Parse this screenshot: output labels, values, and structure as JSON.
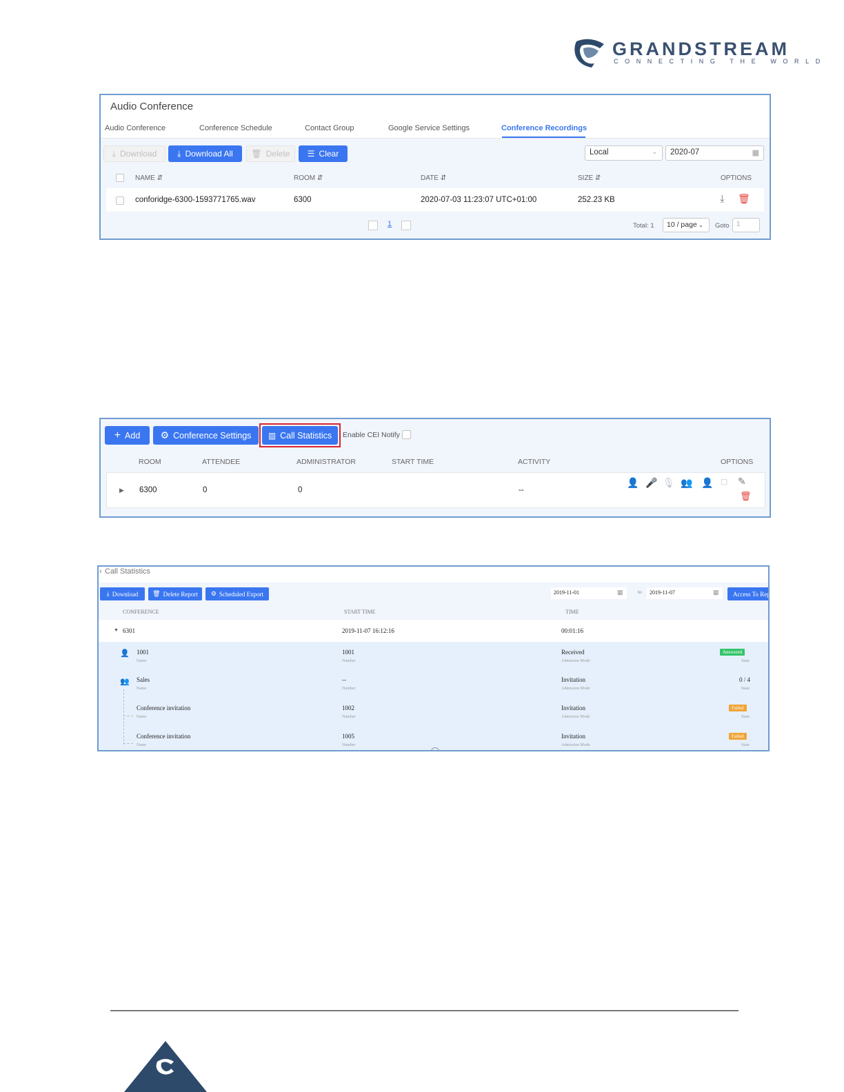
{
  "logo": {
    "word": "GRANDSTREAM",
    "tagline": "CONNECTING THE WORLD"
  },
  "recordings": {
    "title": "Audio Conference",
    "tabs": [
      "Audio Conference",
      "Conference Schedule",
      "Contact Group",
      "Google Service Settings",
      "Conference Recordings"
    ],
    "active_tab": "Conference Recordings",
    "buttons": {
      "download": "Download",
      "download_all": "Download All",
      "delete": "Delete",
      "clear": "Clear"
    },
    "storage": "Local",
    "month": "2020-07",
    "headers": {
      "name": "NAME",
      "room": "ROOM",
      "date": "DATE",
      "size": "SIZE",
      "options": "OPTIONS"
    },
    "rows": [
      {
        "name": "conforidge-6300-1593771765.wav",
        "room": "6300",
        "date": "2020-07-03 11:23:07 UTC+01:00",
        "size": "252.23 KB"
      }
    ],
    "pagination": {
      "page": "1",
      "total": "Total: 1",
      "per_page": "10 / page",
      "goto": "Goto",
      "goto_value": "1"
    }
  },
  "rooms": {
    "buttons": {
      "add": "Add",
      "settings": "Conference Settings",
      "stats": "Call Statistics"
    },
    "cei_label": "Enable CEI Notify",
    "headers": {
      "room": "ROOM",
      "attendee": "ATTENDEE",
      "admin": "ADMINISTRATOR",
      "start": "START TIME",
      "activity": "ACTIVITY",
      "options": "OPTIONS"
    },
    "rows": [
      {
        "room": "6300",
        "attendee": "0",
        "admin": "0",
        "start": "",
        "activity": "--"
      }
    ],
    "highlight_color": "#d9232e"
  },
  "stats": {
    "title": "Call Statistics",
    "buttons": {
      "download": "Download",
      "delete": "Delete Report",
      "export": "Scheduled Export",
      "access": "Access To Rep"
    },
    "date_from": "2019-11-01",
    "date_to": "2019-11-07",
    "to_label": "to",
    "headers": {
      "conference": "CONFERENCE",
      "start": "START TIME",
      "time": "TIME"
    },
    "group": {
      "conf": "6301",
      "start": "2019-11-07 16:12:16",
      "time": "00:01:16"
    },
    "rows": [
      {
        "name": "1001",
        "name_label": "Name",
        "number": "1001",
        "number_label": "Number",
        "mode": "Received",
        "mode_label": "Admission Mode",
        "state": "Answered",
        "state_label": "State"
      },
      {
        "name": "Sales",
        "name_label": "Name",
        "number": "--",
        "number_label": "Number",
        "mode": "Invitation",
        "mode_label": "Admission Mode",
        "state": "0 / 4",
        "state_label": "State"
      },
      {
        "name": "Conference invitation",
        "name_label": "Name",
        "number": "1002",
        "number_label": "Number",
        "mode": "Invitation",
        "mode_label": "Admission Mode",
        "state": "Failed",
        "state_label": "State"
      },
      {
        "name": "Conference invitation",
        "name_label": "Name",
        "number": "1005",
        "number_label": "Number",
        "mode": "Invitation",
        "mode_label": "Admission Mode",
        "state": "Failed",
        "state_label": "State"
      }
    ]
  }
}
